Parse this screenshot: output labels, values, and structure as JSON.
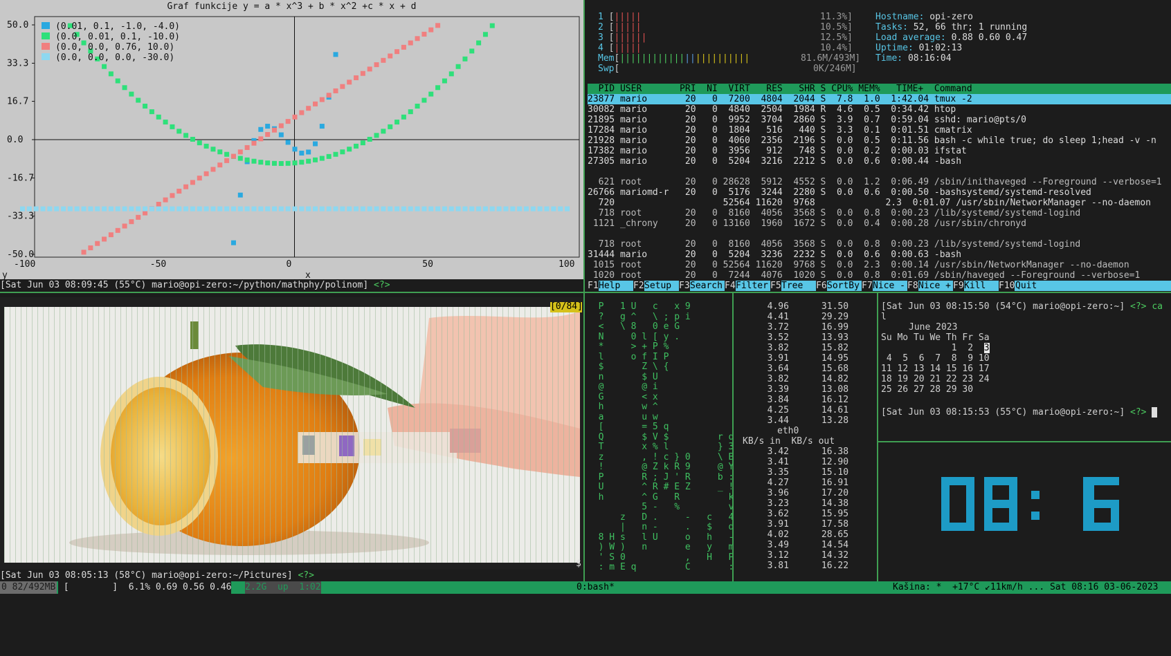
{
  "graph": {
    "title": "Graf funkcije y = a * x^3 + b * x^2 +c * x + d",
    "legend": [
      {
        "label": "(0.01, 0.1, -1.0, -4.0)",
        "color": "#2aa9e0"
      },
      {
        "label": "(0.0, 0.01, 0.1, -10.0)",
        "color": "#2ee07a"
      },
      {
        "label": "(0.0, 0.0, 0.76, 10.0)",
        "color": "#f07f7f"
      },
      {
        "label": "(0.0, 0.0, 0.0, -30.0)",
        "color": "#8ed8f0"
      }
    ],
    "y_ticks": [
      "50.0",
      "33.3",
      "16.7",
      "0.0",
      "-16.7",
      "-33.3",
      "-50.0"
    ],
    "x_ticks": [
      "-100",
      "-50",
      "0",
      "50",
      "100"
    ],
    "xlabel": "x",
    "ylabel": "y",
    "prompt": "[Sat Jun 03 08:09:45 (55°C) mario@opi-zero:~/python/mathphy/polinom]",
    "prompt_tail": "<?>"
  },
  "chart_data": {
    "type": "line",
    "title": "Graf funkcije y = a * x^3 + b * x^2 +c * x + d",
    "xlabel": "x",
    "ylabel": "y",
    "xlim": [
      -100,
      100
    ],
    "ylim": [
      -50,
      50
    ],
    "y_ticks": [
      50.0,
      33.3,
      16.7,
      0.0,
      -16.7,
      -33.3,
      -50.0
    ],
    "x_ticks": [
      -100,
      -50,
      0,
      50,
      100
    ],
    "series": [
      {
        "name": "(0.01, 0.1, -1.0, -4.0)",
        "a": 0.01,
        "b": 0.1,
        "c": -1.0,
        "d": -4.0,
        "color": "#2aa9e0"
      },
      {
        "name": "(0.0, 0.01, 0.1, -10.0)",
        "a": 0.0,
        "b": 0.01,
        "c": 0.1,
        "d": -10.0,
        "color": "#2ee07a"
      },
      {
        "name": "(0.0, 0.0, 0.76, 10.0)",
        "a": 0.0,
        "b": 0.0,
        "c": 0.76,
        "d": 10.0,
        "color": "#f07f7f"
      },
      {
        "name": "(0.0, 0.0, 0.0, -30.0)",
        "a": 0.0,
        "b": 0.0,
        "c": 0.0,
        "d": -30.0,
        "color": "#8ed8f0"
      }
    ]
  },
  "htop": {
    "cpus": [
      {
        "n": "1",
        "bar": "[|||||",
        "pct": "11.3%]"
      },
      {
        "n": "2",
        "bar": "[|||||",
        "pct": "10.5%]"
      },
      {
        "n": "3",
        "bar": "[||||||",
        "pct": "12.5%]"
      },
      {
        "n": "4",
        "bar": "[|||||",
        "pct": "10.4%]"
      }
    ],
    "mem_label": "Mem",
    "mem_bar": "[||||||||||||||||||||||||",
    "mem_val": "81.6M/493M]",
    "swp_label": "Swp",
    "swp_bar": "[",
    "swp_val": "0K/246M]",
    "info": [
      {
        "k": "Hostname: ",
        "v": "opi-zero"
      },
      {
        "k": "Tasks: ",
        "v": "52, 66 thr; 1 running"
      },
      {
        "k": "Load average: ",
        "v": "0.88 0.60 0.47"
      },
      {
        "k": "Uptime: ",
        "v": "01:02:13"
      },
      {
        "k": "Time: ",
        "v": "08:16:04"
      }
    ],
    "header": "  PID USER       PRI  NI  VIRT   RES   SHR S CPU% MEM%   TIME+  Command",
    "rows": [
      "23877 mario       20   0  7200  4804  2044 S  7.8  1.0  1:42.04 tmux -2",
      "30082 mario       20   0  4840  2504  1984 R  4.6  0.5  0:34.42 htop",
      "21895 mario       20   0  9952  3704  2860 S  3.9  0.7  0:59.04 sshd: mario@pts/0",
      "17284 mario       20   0  1804   516   440 S  3.3  0.1  0:01.51 cmatrix",
      "21928 mario       20   0  4060  2356  2196 S  0.0  0.5  0:11.56 bash -c while true; do sleep 1;head -v -n",
      "17382 mario       20   0  3956   912   748 S  0.0  0.2  0:00.03 ifstat",
      "27305 mario       20   0  5204  3216  2212 S  0.0  0.6  0:00.44 -bash",
      "",
      "  621 root        20   0 28628  5912  4552 S  0.0  1.2  0:06.49 /sbin/inithaveged --Foreground --verbose=1",
      "26766 mariomd-r   20   0  5176  3244  2280 S  0.0  0.6  0:00.50 -bashsystemd/systemd-resolved",
      "  720                    52564 11620  9768             2.3  0:01.07 /usr/sbin/NetworkManager --no-daemon",
      "  718 root        20   0  8160  4056  3568 S  0.0  0.8  0:00.23 /lib/systemd/systemd-logind",
      " 1121 _chrony     20   0 13160  1960  1672 S  0.0  0.4  0:00.28 /usr/sbin/chronyd",
      "",
      "  718 root        20   0  8160  4056  3568 S  0.0  0.8  0:00.23 /lib/systemd/systemd-logind",
      "31444 mario       20   0  5204  3236  2232 S  0.0  0.6  0:00.63 -bash",
      " 1015 root        20   0 52564 11620  9768 S  0.0  2.3  0:00.14 /usr/sbin/NetworkManager --no-daemon",
      " 1020 root        20   0  7244  4076  1020 S  0.0  0.8  0:01.69 /sbin/haveged --Foreground --verbose=1"
    ],
    "fkeys": [
      {
        "k": "F1",
        "l": "Help  "
      },
      {
        "k": "F2",
        "l": "Setup "
      },
      {
        "k": "F3",
        "l": "Search"
      },
      {
        "k": "F4",
        "l": "Filter"
      },
      {
        "k": "F5",
        "l": "Tree  "
      },
      {
        "k": "F6",
        "l": "SortBy"
      },
      {
        "k": "F7",
        "l": "Nice -"
      },
      {
        "k": "F8",
        "l": "Nice +"
      },
      {
        "k": "F9",
        "l": "Kill  "
      },
      {
        "k": "F10",
        "l": "Quit"
      }
    ]
  },
  "image_pane": {
    "counter": "[0/84]",
    "prompt": "[Sat Jun 03 08:05:13 (58°C) mario@opi-zero:~/Pictures]",
    "prompt_tail": "<?>",
    "dollar": "$"
  },
  "matrix": {
    "rows": [
      "  P   1 U   c   x 9",
      "  ?   g ^   \\ ; p i",
      "  <   \\ 8   0 e G",
      "  N     0 l [ y .",
      "  *     > + P %",
      "  l     o f I P",
      "  $       Z \\ {",
      "  n       $ U",
      "  @       @ i",
      "  G       < x",
      "  h       w ^",
      "  a       u w",
      "  [       = 5 q",
      "  Q       $ V $         r q",
      "  T       x % l         } 3",
      "  z       , ! c } 0     \\ B",
      "  !       @ Z k R 9     @ Y",
      "  P       R ; J ' R     b :",
      "  U       ^ R # E Z     _ !",
      "  h       ^ G   R         k",
      "          5 -   %         v",
      "      z   D .     -   c   4",
      "      |   n -     .   $   d",
      "  8 H s   l U     o   h   -",
      "  ) W )   n       e   y   m",
      "  ' S 0           ,   H   P",
      "  : m E q         C       :"
    ]
  },
  "ifstat": {
    "top": [
      [
        "4.96",
        "31.50"
      ],
      [
        "4.41",
        "29.29"
      ],
      [
        "3.72",
        "16.99"
      ],
      [
        "3.52",
        "13.93"
      ],
      [
        "3.82",
        "15.82"
      ],
      [
        "3.91",
        "14.95"
      ],
      [
        "3.64",
        "15.68"
      ],
      [
        "3.82",
        "14.82"
      ],
      [
        "3.39",
        "13.08"
      ],
      [
        "3.84",
        "16.12"
      ],
      [
        "4.25",
        "14.61"
      ],
      [
        "3.44",
        "13.28"
      ]
    ],
    "iface": "eth0",
    "cols": "KB/s in  KB/s out",
    "bottom": [
      [
        "3.42",
        "16.38"
      ],
      [
        "3.41",
        "12.90"
      ],
      [
        "3.35",
        "15.10"
      ],
      [
        "4.27",
        "16.91"
      ],
      [
        "3.96",
        "17.20"
      ],
      [
        "3.23",
        "14.38"
      ],
      [
        "3.62",
        "15.95"
      ],
      [
        "3.91",
        "17.58"
      ],
      [
        "4.02",
        "28.65"
      ],
      [
        "3.49",
        "14.54"
      ],
      [
        "3.12",
        "14.32"
      ],
      [
        "3.81",
        "16.22"
      ]
    ]
  },
  "cal_pane": {
    "prompt1": "[Sat Jun 03 08:15:50 (54°C) mario@opi-zero:~]",
    "tail1": "<?> ca",
    "wrap": "l",
    "month": "June 2023",
    "weekdays": "Su Mo Tu We Th Fr Sa",
    "weeks": [
      "             1  2  ",
      " 4  5  6  7  8  9 10",
      "11 12 13 14 15 16 17",
      "18 19 20 21 22 23 24",
      "25 26 27 28 29 30"
    ],
    "today": "3",
    "prompt2": "[Sat Jun 03 08:15:53 (55°C) mario@opi-zero:~]",
    "tail2": "<?>"
  },
  "clock": {
    "time": "08:16"
  },
  "tmux": {
    "left_block": "0 82/492MB",
    "left_rest": " [        ]  6.1% 0.69 0.56 0.46",
    "left_tail": "2.2G  up  1:02",
    "window": "0:bash*",
    "right": "Kašina: *  +17°C ↙11km/h ... Sat 08:16 03-06-2023"
  }
}
